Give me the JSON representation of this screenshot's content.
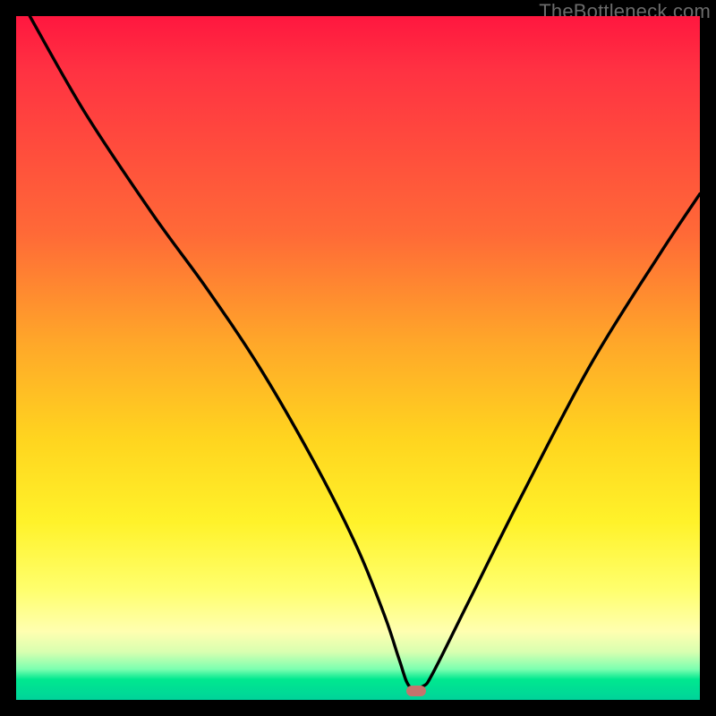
{
  "watermark": "TheBottleneck.com",
  "chart_data": {
    "type": "line",
    "title": "",
    "xlabel": "",
    "ylabel": "",
    "xlim": [
      0,
      100
    ],
    "ylim": [
      0,
      100
    ],
    "background": {
      "gradient": [
        "#ff173f",
        "#ff6a37",
        "#ffd51f",
        "#ffff6e",
        "#00d39a"
      ],
      "direction": "top-to-bottom"
    },
    "series": [
      {
        "name": "bottleneck-curve",
        "x": [
          2,
          10,
          20,
          28,
          36,
          44,
          50,
          54,
          56,
          57.5,
          59.5,
          61,
          66,
          74,
          84,
          94,
          100
        ],
        "y": [
          100,
          86,
          71,
          60,
          48,
          34,
          22,
          12,
          6,
          2,
          2,
          4,
          14,
          30,
          49,
          65,
          74
        ]
      }
    ],
    "marker": {
      "x": 58.5,
      "y": 1.3,
      "color": "#c5746d"
    },
    "grid": false,
    "legend": false
  }
}
